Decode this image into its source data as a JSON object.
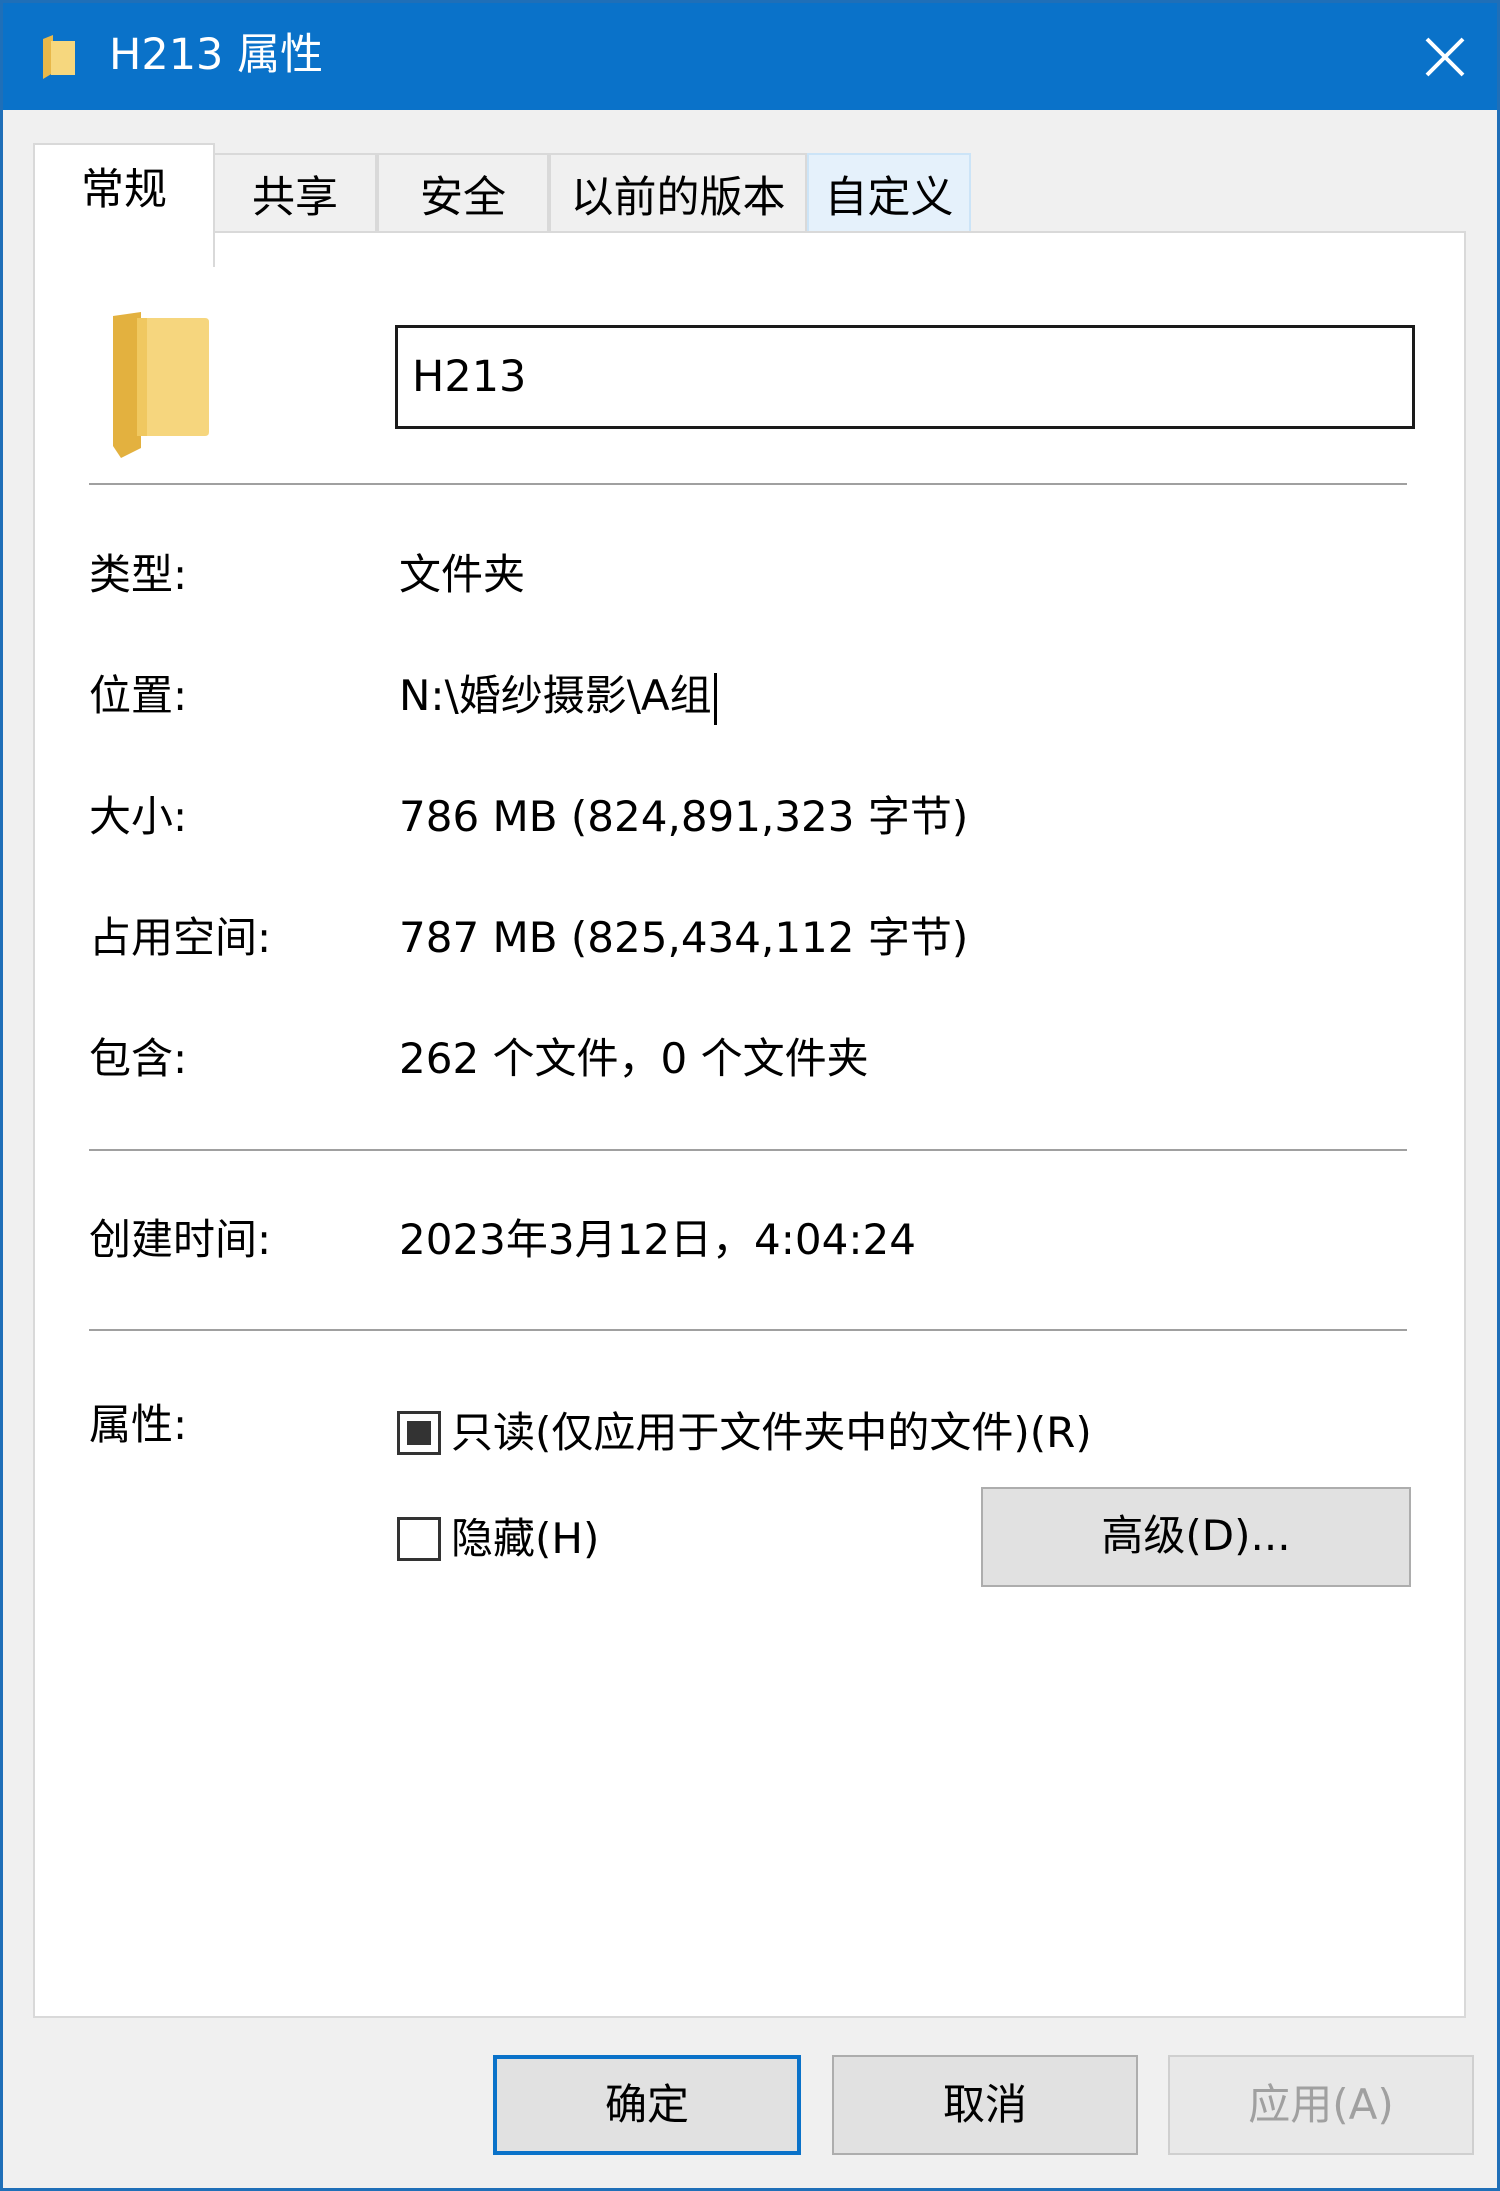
{
  "window": {
    "title": "H213 属性",
    "title_icon": "folder-icon",
    "close_icon": "close-icon"
  },
  "tabs": [
    {
      "label": "常规",
      "active": true
    },
    {
      "label": "共享"
    },
    {
      "label": "安全"
    },
    {
      "label": "以前的版本"
    },
    {
      "label": "自定义"
    }
  ],
  "general": {
    "folder_icon": "folder-icon",
    "name_value": "H213",
    "type": {
      "label": "类型:",
      "value": "文件夹"
    },
    "location": {
      "label": "位置:",
      "value": "N:\\婚纱摄影\\A组"
    },
    "size": {
      "label": "大小:",
      "value": "786 MB (824,891,323 字节)"
    },
    "size_on_disk": {
      "label": "占用空间:",
      "value": "787 MB (825,434,112 字节)"
    },
    "contains": {
      "label": "包含:",
      "value": "262 个文件，0 个文件夹"
    },
    "created": {
      "label": "创建时间:",
      "value": "2023年3月12日，4:04:24"
    },
    "attributes": {
      "label": "属性:",
      "readonly_label": "只读(仅应用于文件夹中的文件)(R)",
      "readonly_state": "indeterminate",
      "hidden_label": "隐藏(H)",
      "hidden_checked": false,
      "advanced_label": "高级(D)..."
    }
  },
  "buttons": {
    "ok": "确定",
    "cancel": "取消",
    "apply": "应用(A)"
  },
  "colors": {
    "titlebar": "#0a72c9",
    "folder": "#f3d57b"
  }
}
